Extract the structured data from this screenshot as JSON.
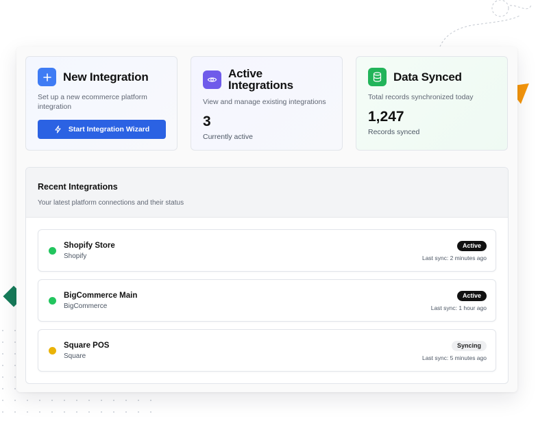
{
  "colors": {
    "accent_blue": "#2b62e3",
    "icon_blue": "#3f7cf4",
    "icon_purple": "#6f5bea",
    "icon_green": "#22b45a",
    "status_active": "#22c55e",
    "status_syncing": "#eab308",
    "deco_diamond": "#167c5a",
    "deco_triangle": "#f5960b"
  },
  "cards": {
    "new_integration": {
      "icon": "plus-icon",
      "title": "New Integration",
      "description": "Set up a new ecommerce platform integration",
      "button_icon": "lightning-icon",
      "button_label": "Start Integration Wizard"
    },
    "active_integrations": {
      "icon": "eye-icon",
      "title": "Active Integrations",
      "description": "View and manage existing integrations",
      "value": "3",
      "sub": "Currently active"
    },
    "data_synced": {
      "icon": "database-icon",
      "title": "Data Synced",
      "description": "Total records synchronized today",
      "value": "1,247",
      "sub": "Records synced"
    }
  },
  "recent": {
    "title": "Recent Integrations",
    "subtitle": "Your latest platform connections and their status",
    "items": [
      {
        "name": "Shopify Store",
        "platform": "Shopify",
        "status": "Active",
        "last_sync": "Last sync: 2 minutes ago"
      },
      {
        "name": "BigCommerce Main",
        "platform": "BigCommerce",
        "status": "Active",
        "last_sync": "Last sync: 1 hour ago"
      },
      {
        "name": "Square POS",
        "platform": "Square",
        "status": "Syncing",
        "last_sync": "Last sync: 5 minutes ago"
      }
    ]
  }
}
